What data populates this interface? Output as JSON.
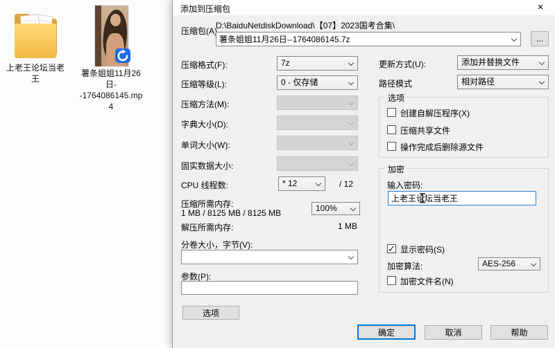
{
  "desktop": {
    "folder": {
      "label": "上老王论坛当老王"
    },
    "video": {
      "label": "薯条姐姐11月26日--1764086145.mp4",
      "badge_icon": "circular-arrow-player-badge"
    }
  },
  "dialog": {
    "title": "添加到压缩包",
    "close_icon": "×",
    "archive": {
      "label": "压缩包(A)",
      "dir": "D:\\BaiduNetdiskDownload\\【07】2023国考合集\\",
      "name": "薯条姐姐11月26日--1764086145.7z",
      "browse_label": "..."
    },
    "left": {
      "format": {
        "label": "压缩格式(F):",
        "value": "7z"
      },
      "level": {
        "label": "压缩等级(L):",
        "value": "0 - 仅存储"
      },
      "method": {
        "label": "压缩方法(M):",
        "value": ""
      },
      "dict": {
        "label": "字典大小(D):",
        "value": ""
      },
      "word": {
        "label": "单词大小(W):",
        "value": ""
      },
      "solid": {
        "label": "固实数据大小:",
        "value": ""
      },
      "cpu": {
        "label": "CPU 线程数:",
        "value": "* 12",
        "total": "/ 12"
      },
      "mem": {
        "label": "压缩所需内存:",
        "detail": "1 MB / 8125 MB / 8125 MB",
        "percent": "100%"
      },
      "mem_dec": {
        "label": "解压所需内存:",
        "value": "1 MB"
      },
      "split": {
        "label": "分卷大小，字节(V):",
        "value": ""
      },
      "params": {
        "label": "参数(P):",
        "value": ""
      },
      "options_button": "选项"
    },
    "right": {
      "update": {
        "label": "更新方式(U):",
        "value": "添加并替换文件"
      },
      "path_mode": {
        "label": "路径模式",
        "value": "相对路径"
      },
      "options_group": {
        "title": "选项",
        "sfx": {
          "label": "创建自解压程序(X)",
          "checked": false
        },
        "shared": {
          "label": "压缩共享文件",
          "checked": false
        },
        "delete": {
          "label": "操作完成后删除源文件",
          "checked": false
        }
      },
      "encryption": {
        "title": "加密",
        "password_label": "输入密码:",
        "password_value": "上老王论坛当老王",
        "show_password": {
          "label": "显示密码(S)",
          "checked": true
        },
        "method": {
          "label": "加密算法:",
          "value": "AES-256"
        },
        "encrypt_names": {
          "label": "加密文件名(N)",
          "checked": false
        }
      }
    },
    "footer": {
      "ok": "确定",
      "cancel": "取消",
      "help": "帮助"
    }
  }
}
